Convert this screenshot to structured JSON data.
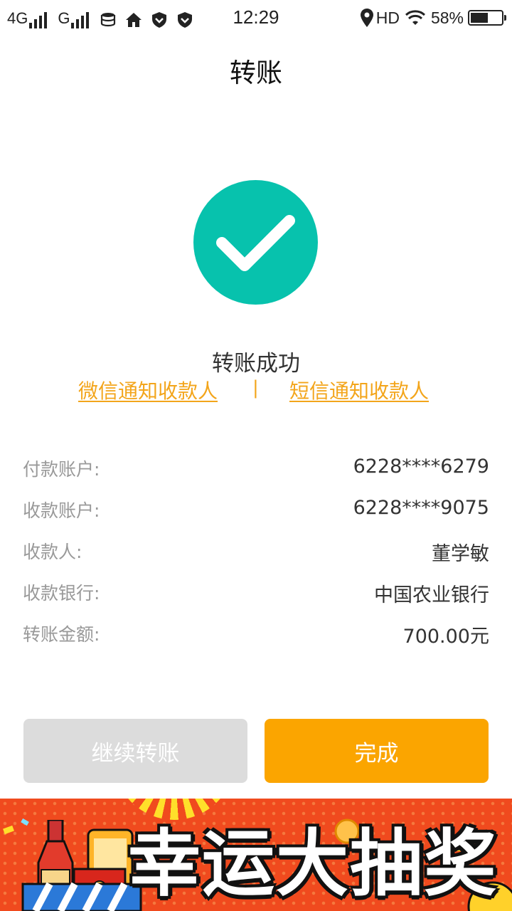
{
  "status_bar": {
    "net1": "4G",
    "net2": "G",
    "time": "12:29",
    "hd": "HD",
    "battery_text": "58%",
    "battery_level": 0.58
  },
  "header": {
    "title": "转账"
  },
  "result": {
    "message": "转账成功",
    "icon": "check-circle-icon",
    "color": "#07c2ad"
  },
  "notify": {
    "wechat_label": "微信通知收款人",
    "separator": "|",
    "sms_label": "短信通知收款人",
    "color": "#f3a51b"
  },
  "details": [
    {
      "label": "付款账户:",
      "value": "6228****6279"
    },
    {
      "label": "收款账户:",
      "value": "6228****9075"
    },
    {
      "label": "收款人:",
      "value": "董学敏"
    },
    {
      "label": "收款银行:",
      "value": "中国农业银行"
    },
    {
      "label": "转账金额:",
      "value": "700.00元"
    }
  ],
  "buttons": {
    "continue_label": "继续转账",
    "done_label": "完成",
    "done_color": "#fba500"
  },
  "banner": {
    "text": "幸运大抽奖"
  }
}
